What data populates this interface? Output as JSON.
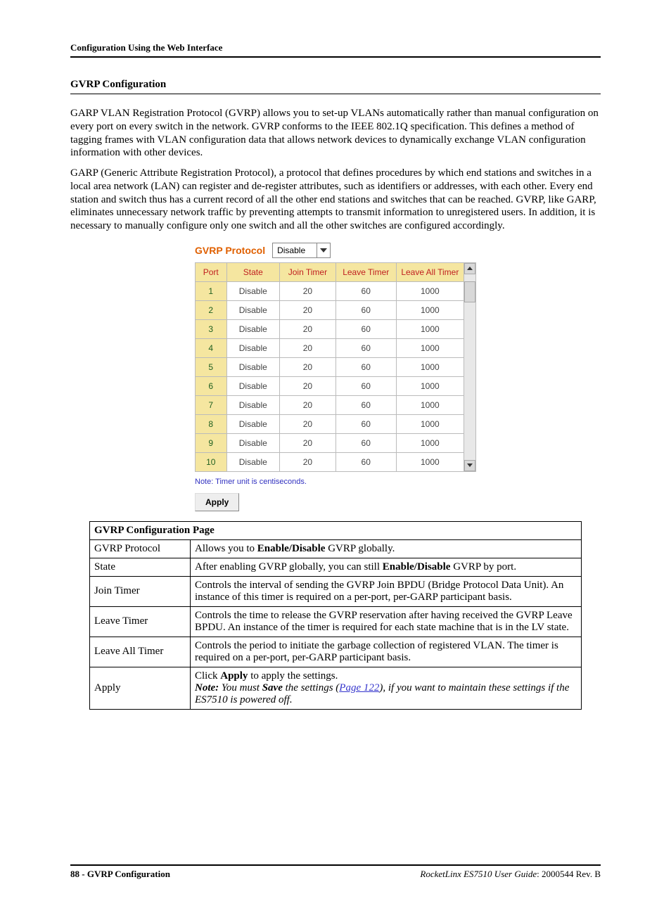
{
  "header": {
    "breadcrumb": "Configuration Using the Web Interface"
  },
  "section_title": "GVRP Configuration",
  "paragraphs": {
    "p1": "GARP VLAN Registration Protocol (GVRP) allows you to set-up VLANs automatically rather than manual configuration on every port on every switch in the network. GVRP conforms to the IEEE 802.1Q specification. This defines a method of tagging frames with VLAN configuration data that allows network devices to dynamically exchange VLAN configuration information with other devices.",
    "p2": "GARP (Generic Attribute Registration Protocol), a protocol that defines procedures by which end stations and switches in a local area network (LAN) can register and de-register attributes, such as identifiers or addresses, with each other. Every end station and switch thus has a current record of all the other end stations and switches that can be reached. GVRP, like GARP, eliminates unnecessary network traffic by preventing attempts to transmit information to unregistered users. In addition, it is necessary to manually configure only one switch and all the other switches are configured accordingly."
  },
  "ui": {
    "title": "GVRP Protocol",
    "select_value": "Disable",
    "columns": {
      "port": "Port",
      "state": "State",
      "join": "Join Timer",
      "leave": "Leave Timer",
      "leaveall": "Leave All Timer"
    },
    "rows": [
      {
        "port": "1",
        "state": "Disable",
        "join": "20",
        "leave": "60",
        "leaveall": "1000"
      },
      {
        "port": "2",
        "state": "Disable",
        "join": "20",
        "leave": "60",
        "leaveall": "1000"
      },
      {
        "port": "3",
        "state": "Disable",
        "join": "20",
        "leave": "60",
        "leaveall": "1000"
      },
      {
        "port": "4",
        "state": "Disable",
        "join": "20",
        "leave": "60",
        "leaveall": "1000"
      },
      {
        "port": "5",
        "state": "Disable",
        "join": "20",
        "leave": "60",
        "leaveall": "1000"
      },
      {
        "port": "6",
        "state": "Disable",
        "join": "20",
        "leave": "60",
        "leaveall": "1000"
      },
      {
        "port": "7",
        "state": "Disable",
        "join": "20",
        "leave": "60",
        "leaveall": "1000"
      },
      {
        "port": "8",
        "state": "Disable",
        "join": "20",
        "leave": "60",
        "leaveall": "1000"
      },
      {
        "port": "9",
        "state": "Disable",
        "join": "20",
        "leave": "60",
        "leaveall": "1000"
      },
      {
        "port": "10",
        "state": "Disable",
        "join": "20",
        "leave": "60",
        "leaveall": "1000"
      }
    ],
    "note": "Note: Timer unit is centiseconds.",
    "apply": "Apply"
  },
  "desc": {
    "title": "GVRP Configuration Page",
    "rows": {
      "gvrp_protocol": {
        "label": "GVRP Protocol",
        "pre": "Allows you to ",
        "bold": "Enable/Disable",
        "post": " GVRP globally."
      },
      "state": {
        "label": "State",
        "pre": "After enabling GVRP globally, you can still ",
        "bold": "Enable/Disable",
        "post": " GVRP by port."
      },
      "join_timer": {
        "label": "Join Timer",
        "text": "Controls the interval of sending the GVRP Join BPDU (Bridge Protocol Data Unit). An instance of this timer is required on a per-port, per-GARP participant basis."
      },
      "leave_timer": {
        "label": "Leave Timer",
        "text": "Controls the time to release the GVRP reservation after having received the GVRP Leave BPDU. An instance of the timer is required for each state machine that is in the LV state."
      },
      "leave_all_timer": {
        "label": "Leave All Timer",
        "text": "Controls the period to initiate the garbage collection of registered VLAN. The timer is required on a per-port, per-GARP participant basis."
      },
      "apply": {
        "label": "Apply",
        "line1_pre": "Click ",
        "line1_bold": "Apply",
        "line1_post": " to apply the settings.",
        "note_label": "Note:",
        "note_pre": "  You must ",
        "note_bold": "Save",
        "note_mid": " the settings (",
        "note_link": "Page 122",
        "note_post": "), if you want to maintain these settings if the ES7510 is powered off."
      }
    }
  },
  "footer": {
    "left": "88 - GVRP Configuration",
    "right_italic": "RocketLinx ES7510  User Guide",
    "right_rest": ": 2000544 Rev. B"
  }
}
